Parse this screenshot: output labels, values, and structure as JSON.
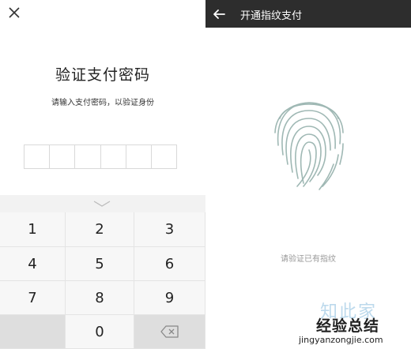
{
  "password_screen": {
    "title": "验证支付密码",
    "subtitle": "请输入支付密码，以验证身份",
    "box_count": 6,
    "keys": [
      {
        "label": "1",
        "name": "key-1"
      },
      {
        "label": "2",
        "name": "key-2"
      },
      {
        "label": "3",
        "name": "key-3"
      },
      {
        "label": "4",
        "name": "key-4"
      },
      {
        "label": "5",
        "name": "key-5"
      },
      {
        "label": "6",
        "name": "key-6"
      },
      {
        "label": "7",
        "name": "key-7"
      },
      {
        "label": "8",
        "name": "key-8"
      },
      {
        "label": "9",
        "name": "key-9"
      },
      {
        "label": "",
        "name": "key-blank"
      },
      {
        "label": "0",
        "name": "key-0"
      },
      {
        "label": "",
        "name": "key-delete"
      }
    ],
    "icons": {
      "close": "close-icon",
      "collapse": "chevron-down-icon",
      "delete": "backspace-icon"
    }
  },
  "fingerprint_screen": {
    "title": "开通指纹支付",
    "prompt": "请验证已有指纹",
    "icons": {
      "back": "arrow-left-icon",
      "fingerprint": "fingerprint-icon"
    },
    "colors": {
      "header_bg": "#2d2d2d",
      "fingerprint": "#9fb8b4"
    }
  },
  "watermark": {
    "logo": "知此家",
    "site_cn": "经验总结",
    "url": "jingyanzongjie.com"
  }
}
